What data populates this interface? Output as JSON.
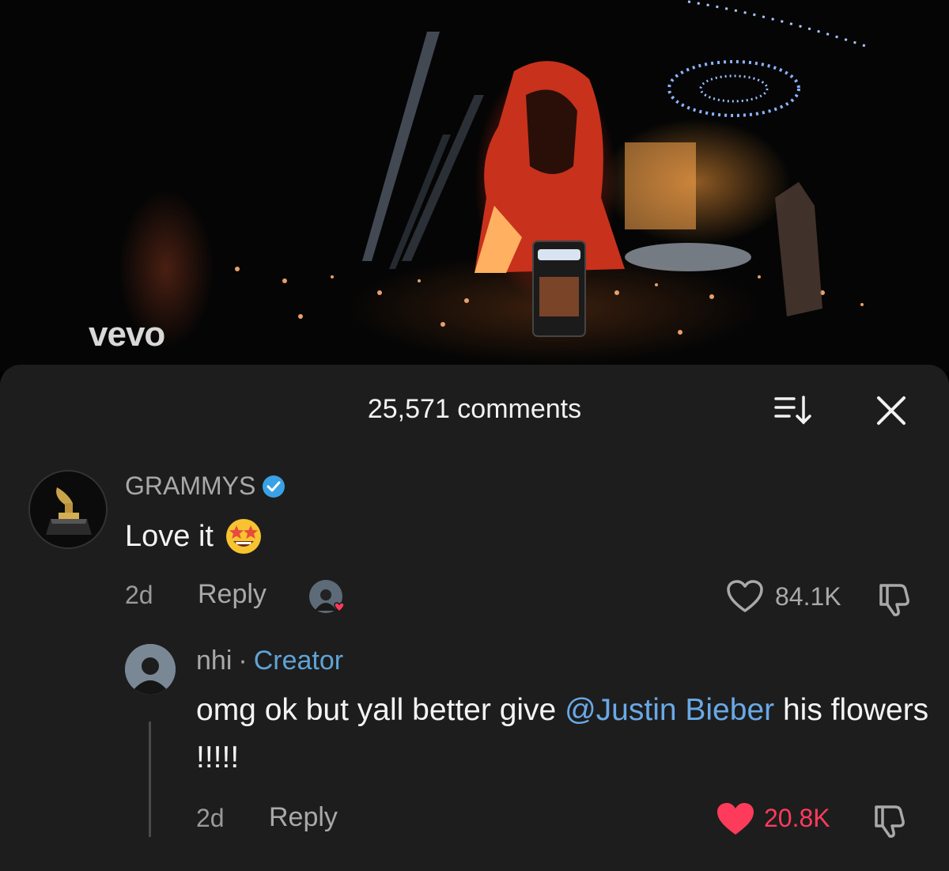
{
  "video": {
    "watermark": "vevo"
  },
  "comments_sheet": {
    "title": "25,571 comments",
    "sort_icon": "sort-down-icon",
    "close_icon": "close-icon"
  },
  "comment": {
    "username": "GRAMMYS",
    "verified_icon": "verified-badge-icon",
    "text": "Love it",
    "emoji": "star-struck-emoji",
    "age": "2d",
    "reply_label": "Reply",
    "likes": "84.1K",
    "liked": false
  },
  "reply": {
    "username": "nhi",
    "separator": "·",
    "badge": "Creator",
    "text_before": "omg ok but yall better give ",
    "mention": "@Justin Bieber",
    "text_after": " his flowers !!!!!",
    "age": "2d",
    "reply_label": "Reply",
    "likes": "20.8K",
    "liked": true
  },
  "colors": {
    "sheet_bg": "#1d1d1d",
    "creator_accent": "#5fa4d6",
    "mention": "#6aa9e8",
    "like_active": "#ff3b5c"
  }
}
